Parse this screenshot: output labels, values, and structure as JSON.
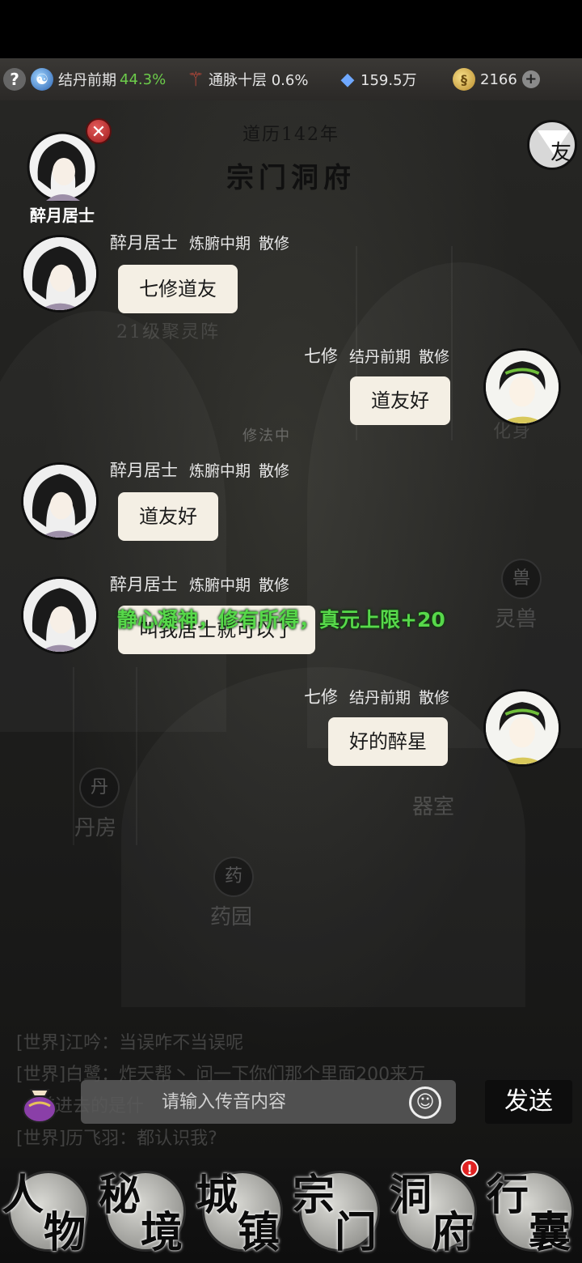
{
  "status": {
    "realm_label": "结丹前期",
    "realm_pct": "44.3%",
    "meridian": "通脉十层 0.6%",
    "spirit_stones": "159.5万",
    "gold": "2166"
  },
  "header": {
    "era": "道历142年",
    "place": "宗门洞府",
    "daoyou_label": "友"
  },
  "top_character": {
    "name": "醉月居士"
  },
  "messages": [
    {
      "name": "醉月居士",
      "realm": "炼腑中期",
      "sect": "散修",
      "text": "七修道友",
      "side": "left"
    },
    {
      "name": "七修",
      "realm": "结丹前期",
      "sect": "散修",
      "text": "道友好",
      "side": "right"
    },
    {
      "name": "醉月居士",
      "realm": "炼腑中期",
      "sect": "散修",
      "text": "道友好",
      "side": "left"
    },
    {
      "name": "醉月居士",
      "realm": "炼腑中期",
      "sect": "散修",
      "text": "叫我居士就可以了",
      "side": "left"
    },
    {
      "name": "七修",
      "realm": "结丹前期",
      "sect": "散修",
      "text": "好的醉星",
      "side": "right"
    }
  ],
  "floating_text": "静心凝神，修有所得，真元上限+20",
  "background_labels": {
    "array": "21级聚灵阵",
    "cultivating": "修法中",
    "avatar_label": "化身",
    "beast_icon": "兽",
    "beast_name": "灵兽",
    "equip_name": "器室",
    "alchemy_icon": "丹",
    "alchemy_name": "丹房",
    "herb_icon": "药",
    "herb_name": "药园"
  },
  "world_chat": [
    "[世界]江吟：当误咋不当误呢",
    "[世界]白鹭：炸天帮丶 问一下你们那个里面200来万",
    "[世界]历飞羽：都认识我?"
  ],
  "world_chat_partial": "前进去的是什",
  "input": {
    "placeholder": "请输入传音内容"
  },
  "send_label": "发送",
  "nav": [
    {
      "c1": "人",
      "c2": "物"
    },
    {
      "c1": "秘",
      "c2": "境"
    },
    {
      "c1": "城",
      "c2": "镇"
    },
    {
      "c1": "宗",
      "c2": "门"
    },
    {
      "c1": "洞",
      "c2": "府"
    },
    {
      "c1": "行",
      "c2": "囊"
    }
  ],
  "nav_badge": "!"
}
